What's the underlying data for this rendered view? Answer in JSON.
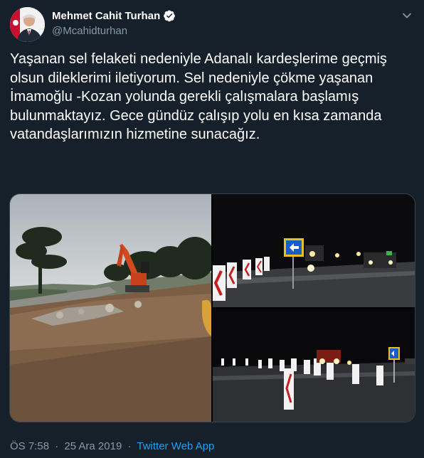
{
  "author": {
    "name": "Mehmet Cahit Turhan",
    "handle": "@Mcahidturhan",
    "verified": true
  },
  "tweet": {
    "text": "Yaşanan sel felaketi nedeniyle Adanalı kardeşlerime geçmiş olsun dileklerimi iletiyorum. Sel nedeniyle çökme yaşanan İmamoğlu -Kozan yolunda gerekli çalışmalara başlamış bulunmaktayız. Gece gündüz çalışıp yolu en kısa zamanda  vatandaşlarımızın hizmetine sunacağız.",
    "time": "ÖS 7:58",
    "separator": "·",
    "date": "25 Ara 2019",
    "source": "Twitter Web App"
  },
  "media": {
    "count": 3,
    "photos": [
      "excavator-roadwork-photo",
      "night-road-signs-photo",
      "night-detour-photo"
    ]
  },
  "icons": {
    "verified": "verified-badge-icon",
    "caret": "chevron-down-icon"
  },
  "colors": {
    "background": "#15202b",
    "text": "#ffffff",
    "secondary": "#8899a6",
    "link": "#1da1f2",
    "border": "#38444d"
  }
}
